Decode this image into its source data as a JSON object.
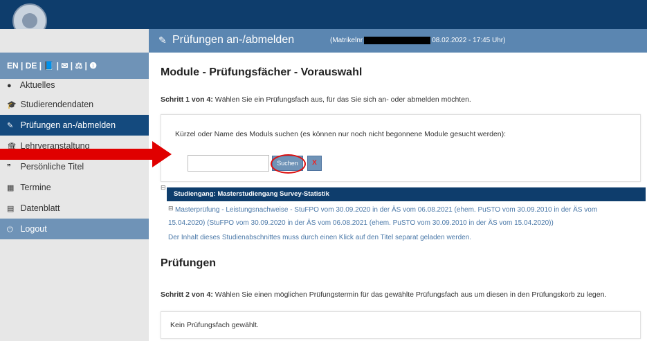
{
  "branding": {
    "logo_icon": "university-seal-icon"
  },
  "sidebar": {
    "lang_bar": "EN | DE | 📘 | ✉ | ⚖ | ❶",
    "items": [
      {
        "label": "Aktuelles",
        "icon": "chat-bubble-icon",
        "glyph": "●"
      },
      {
        "label": "Studierendendaten",
        "icon": "graduation-cap-icon",
        "glyph": "🎓"
      },
      {
        "label": "Prüfungen an-/abmelden",
        "icon": "edit-icon",
        "glyph": "✎",
        "active": true
      },
      {
        "label": "Lehrveranstaltung",
        "icon": "institution-icon",
        "glyph": "🏛"
      },
      {
        "label": "Persönliche Titel",
        "icon": "quote-icon",
        "glyph": "❞"
      },
      {
        "label": "Termine",
        "icon": "calendar-icon",
        "glyph": "▦"
      },
      {
        "label": "Datenblatt",
        "icon": "document-icon",
        "glyph": "▤"
      },
      {
        "label": "Logout",
        "icon": "power-icon",
        "glyph": "⏻"
      }
    ]
  },
  "header": {
    "icon": "edit-icon",
    "title": "Prüfungen an-/abmelden",
    "meta_prefix": "(Matrikelnr",
    "meta_suffix": "08.02.2022 - 17:45 Uhr)"
  },
  "module_section": {
    "heading": "Module - Prüfungsfächer - Vorauswahl",
    "step_label": "Schritt 1 von 4:",
    "step_text": "Wählen Sie ein Prüfungsfach aus, für das Sie sich an- oder abmelden möchten.",
    "search_label": "Kürzel oder Name des Moduls suchen (es können nur noch nicht begonnene Module gesucht werden):",
    "search_value": "",
    "search_button": "Suchen",
    "clear_button": "X"
  },
  "studiengang": {
    "toggle": "⊟",
    "title": "Studiengang: Masterstudiengang Survey-Statistik",
    "sub_toggle": "⊟",
    "link_line1": "Masterprüfung - Leistungsnachweise - StuFPO vom 30.09.2020 in der ÄS vom 06.08.2021 (ehem. PuSTO vom 30.09.2010 in der ÄS vom",
    "link_line2": "15.04.2020) (StuFPO vom 30.09.2020 in der ÄS vom 06.08.2021 (ehem. PuSTO vom 30.09.2010 in der ÄS vom 15.04.2020))",
    "note": "Der Inhalt dieses Studienabschnittes muss durch einen Klick auf den Titel separat geladen werden."
  },
  "pruefungen_section": {
    "heading": "Prüfungen",
    "step_label": "Schritt 2 von 4:",
    "step_text": "Wählen Sie einen möglichen Prüfungstermin für das gewählte Prüfungsfach aus um diesen in den Prüfungskorb zu legen.",
    "empty_text": "Kein Prüfungsfach gewählt."
  },
  "colors": {
    "brand_dark": "#0e3d6c",
    "header": "#5b86b1",
    "accent": "#6f93b7",
    "annotation_red": "#e00000"
  }
}
